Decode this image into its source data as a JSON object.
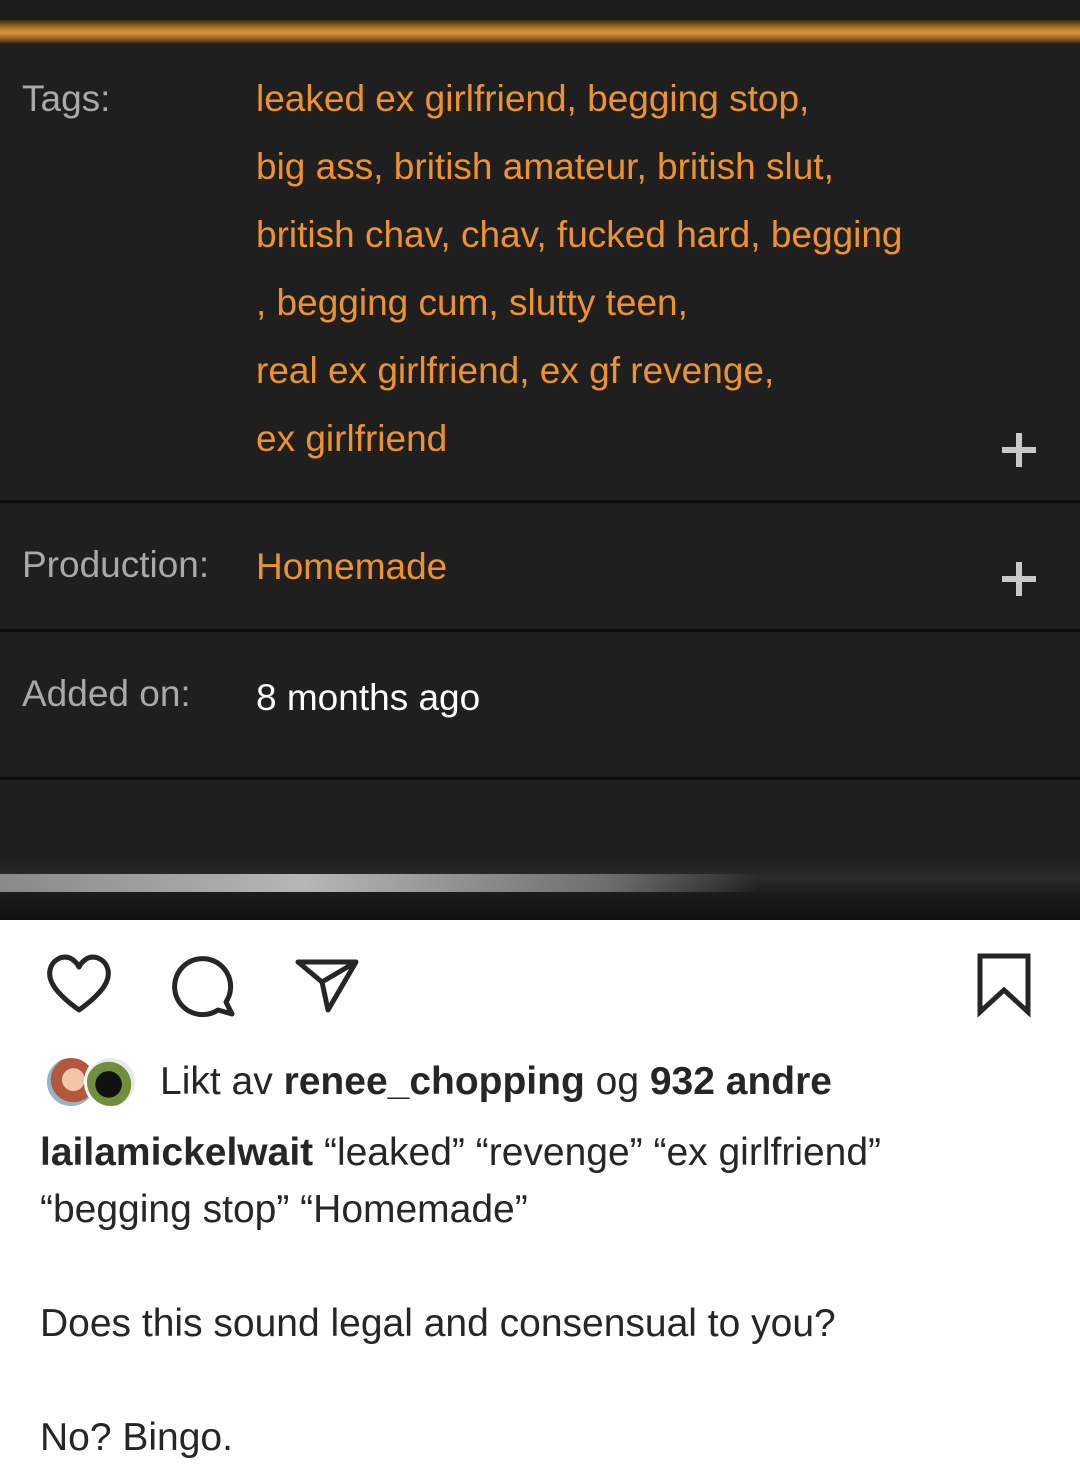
{
  "screenshot": {
    "labels": {
      "tags": "Tags:",
      "production": "Production:",
      "added_on": "Added on:"
    },
    "tag_lines": [
      "leaked ex girlfriend, begging stop,",
      "big ass, british amateur, british slut,",
      "british chav, chav, fucked hard, begging",
      ", begging cum, slutty teen,",
      "real ex girlfriend, ex gf revenge,",
      "ex girlfriend"
    ],
    "production_value": "Homemade",
    "added_on_value": "8 months ago",
    "icons": {
      "expand_tags": "plus-icon",
      "expand_production": "plus-icon"
    },
    "colors": {
      "background": "#1f1f1f",
      "tag_text": "#f0922a",
      "label_text": "#a9a9a9",
      "accent_bar": "#d8923a"
    }
  },
  "post": {
    "actions": {
      "like": "heart-icon",
      "comment": "comment-bubble-icon",
      "share": "paper-plane-icon",
      "save": "bookmark-icon"
    },
    "likes": {
      "prefix": "Likt av ",
      "user": "renee_chopping",
      "middle": " og ",
      "count": "932 andre"
    },
    "caption": {
      "username": "lailamickelwait",
      "line1": " “leaked” “revenge” “ex girlfriend”",
      "line2": "“begging stop” “Homemade”",
      "line3": "Does this sound legal and consensual to you?",
      "line4": "No? Bingo."
    }
  }
}
